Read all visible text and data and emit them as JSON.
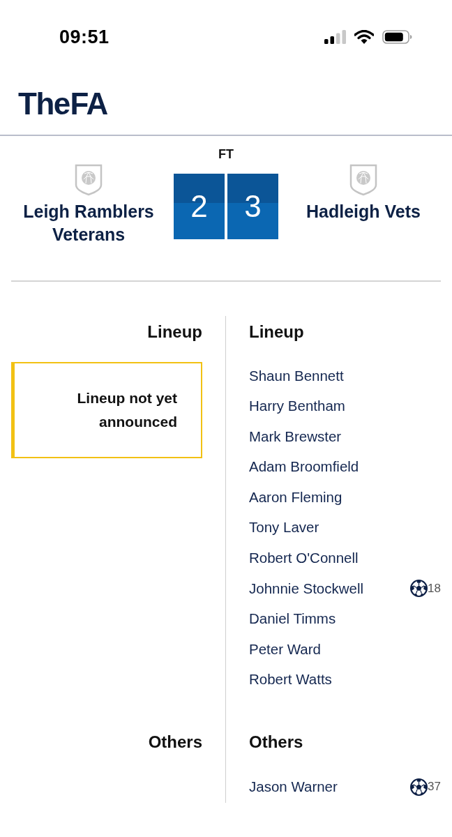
{
  "status_bar": {
    "time": "09:51"
  },
  "header": {
    "logo": "The FA"
  },
  "match": {
    "status": "FT",
    "home": {
      "name": "Leigh Ramblers Veterans",
      "score": "2"
    },
    "away": {
      "name": "Hadleigh Vets",
      "score": "3"
    }
  },
  "lineups": {
    "home": {
      "heading": "Lineup",
      "notice": "Lineup not yet announced",
      "others_heading": "Others"
    },
    "away": {
      "heading": "Lineup",
      "players": [
        {
          "name": "Shaun Bennett"
        },
        {
          "name": "Harry Bentham"
        },
        {
          "name": "Mark Brewster"
        },
        {
          "name": "Adam Broomfield"
        },
        {
          "name": "Aaron Fleming"
        },
        {
          "name": "Tony Laver"
        },
        {
          "name": "Robert O'Connell"
        },
        {
          "name": "Johnnie Stockwell",
          "goal": "18"
        },
        {
          "name": "Daniel Timms"
        },
        {
          "name": "Peter Ward"
        },
        {
          "name": "Robert Watts"
        }
      ],
      "others_heading": "Others",
      "others": [
        {
          "name": "Jason Warner",
          "goal": "37"
        }
      ]
    }
  }
}
